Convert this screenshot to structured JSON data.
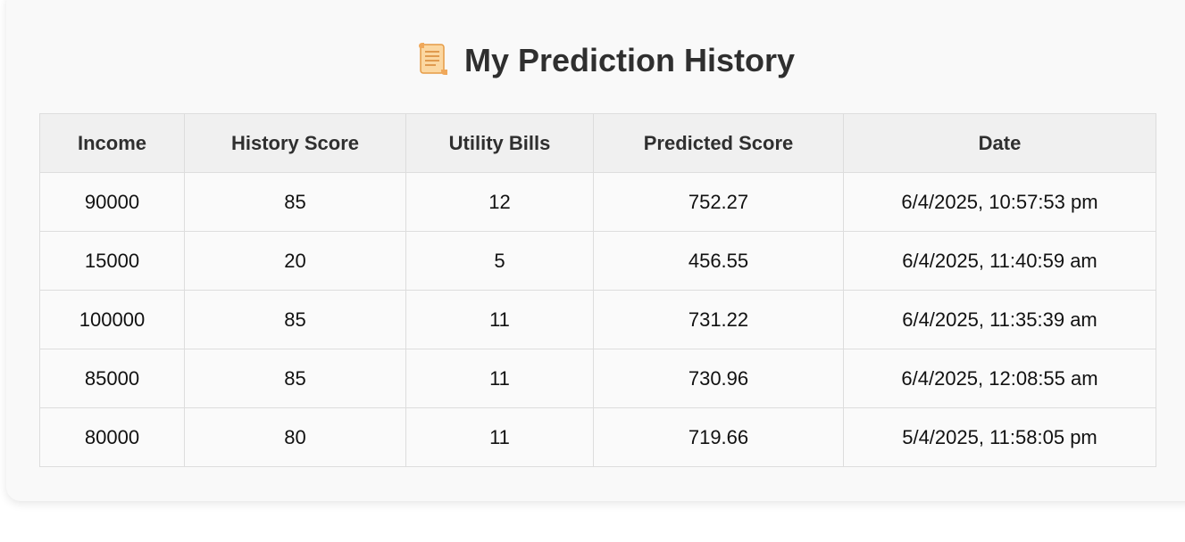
{
  "page": {
    "title": "My Prediction History",
    "title_icon": "scroll-icon"
  },
  "table": {
    "headers": [
      "Income",
      "History Score",
      "Utility Bills",
      "Predicted Score",
      "Date"
    ],
    "rows": [
      [
        "90000",
        "85",
        "12",
        "752.27",
        "6/4/2025, 10:57:53 pm"
      ],
      [
        "15000",
        "20",
        "5",
        "456.55",
        "6/4/2025, 11:40:59 am"
      ],
      [
        "100000",
        "85",
        "11",
        "731.22",
        "6/4/2025, 11:35:39 am"
      ],
      [
        "85000",
        "85",
        "11",
        "730.96",
        "6/4/2025, 12:08:55 am"
      ],
      [
        "80000",
        "80",
        "11",
        "719.66",
        "5/4/2025, 11:58:05 pm"
      ]
    ]
  },
  "colors": {
    "card_bg": "#f9f9f9",
    "header_bg": "#f0f0f0",
    "cell_bg": "#fafafa",
    "border": "#dddddd",
    "title_text": "#2f2f2f",
    "scroll_icon": "#f4c27a"
  }
}
